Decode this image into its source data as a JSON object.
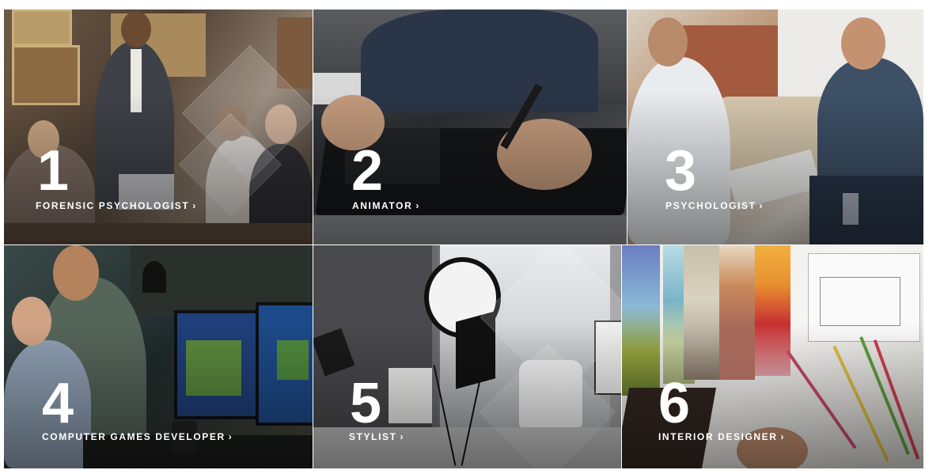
{
  "tiles": [
    {
      "number": "1",
      "label": "FORENSIC PSYCHOLOGIST",
      "chevron": "›",
      "icon": "chevron-right-icon"
    },
    {
      "number": "2",
      "label": "ANIMATOR",
      "chevron": "›",
      "icon": "chevron-right-icon"
    },
    {
      "number": "3",
      "label": "PSYCHOLOGIST",
      "chevron": "›",
      "icon": "chevron-right-icon"
    },
    {
      "number": "4",
      "label": "COMPUTER GAMES DEVELOPER",
      "chevron": "›",
      "icon": "chevron-right-icon"
    },
    {
      "number": "5",
      "label": "STYLIST",
      "chevron": "›",
      "icon": "chevron-right-icon"
    },
    {
      "number": "6",
      "label": "INTERIOR DESIGNER",
      "chevron": "›",
      "icon": "chevron-right-icon"
    }
  ],
  "colors": {
    "text": "#ffffff",
    "tile1": "#5a4a3c",
    "tile2": "#2a2a2c",
    "tile3": "#a8886e",
    "tile4": "#2f3a3e",
    "tile5": "#6a6a6e",
    "tile6": "#e4e2de"
  }
}
